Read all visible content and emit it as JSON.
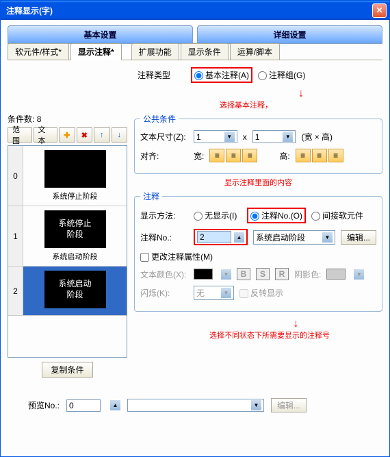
{
  "title": "注释显示(字)",
  "main_tabs": [
    "基本设置",
    "详细设置"
  ],
  "sub_tabs_left": [
    "软元件/样式*",
    "显示注释*"
  ],
  "sub_tabs_right": [
    "扩展功能",
    "显示条件",
    "运算/脚本"
  ],
  "count_label": "条件数:",
  "count_value": "8",
  "toolbar": {
    "range": "范围",
    "text": "文本"
  },
  "preview_items": [
    {
      "num": "0",
      "box_text": "",
      "label": "系统停止阶段",
      "selected": false
    },
    {
      "num": "1",
      "box_text": "系统停止\n阶段",
      "label": "系统启动阶段",
      "selected": false
    },
    {
      "num": "2",
      "box_text": "系统启动\n阶段",
      "label": "",
      "selected": true
    }
  ],
  "copy_btn": "复制条件",
  "type_label": "注释类型",
  "type_basic": "基本注释(A)",
  "type_group": "注释组(G)",
  "anno_select_basic": "选择基本注释，",
  "common_legend": "公共条件",
  "text_size_label": "文本尺寸(Z):",
  "size_w": "1",
  "size_h": "1",
  "size_x": "x",
  "size_unit": "(宽 × 高)",
  "align_label": "对齐:",
  "align_w": "宽:",
  "align_h": "高:",
  "anno_show_content": "显示注释里面的内容",
  "comment_legend": "注释",
  "display_method_label": "显示方法:",
  "display_none": "无显示(I)",
  "display_no": "注释No.(O)",
  "display_indirect": "间接软元件",
  "comment_no_label": "注释No.:",
  "comment_no_value": "2",
  "comment_select": "系统启动阶段",
  "edit_btn": "编辑...",
  "change_attr": "更改注释属性(M)",
  "text_color_label": "文本颜色(X):",
  "shadow_label": "阴影色:",
  "blink_label": "闪烁(K):",
  "blink_value": "无",
  "invert_label": "反转显示",
  "anno_select_state": "选择不同状态下所需要显示的注释号",
  "preview_no_label": "预览No.:",
  "preview_no_value": "0",
  "preview_edit": "编辑..."
}
